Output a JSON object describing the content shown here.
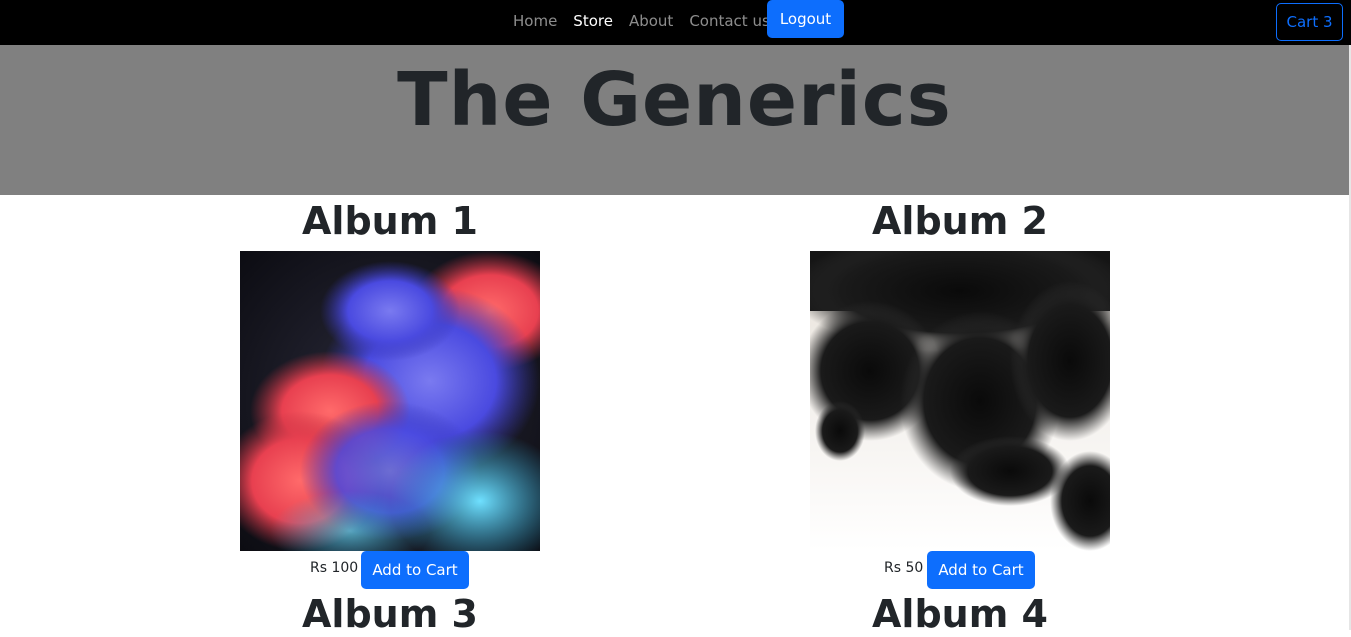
{
  "nav": {
    "links": [
      "Home",
      "Store",
      "About",
      "Contact us"
    ],
    "active": "Store",
    "logout_label": "Logout",
    "cart_label": "Cart 3"
  },
  "hero": {
    "title": "The Generics"
  },
  "albums": [
    {
      "title": "Album 1",
      "price": "Rs 100",
      "button": "Add to Cart"
    },
    {
      "title": "Album 2",
      "price": "Rs 50",
      "button": "Add to Cart"
    },
    {
      "title": "Album 3"
    },
    {
      "title": "Album 4"
    }
  ],
  "colors": {
    "primary": "#0d6efd",
    "navbar": "#000000",
    "hero": "#808080"
  }
}
